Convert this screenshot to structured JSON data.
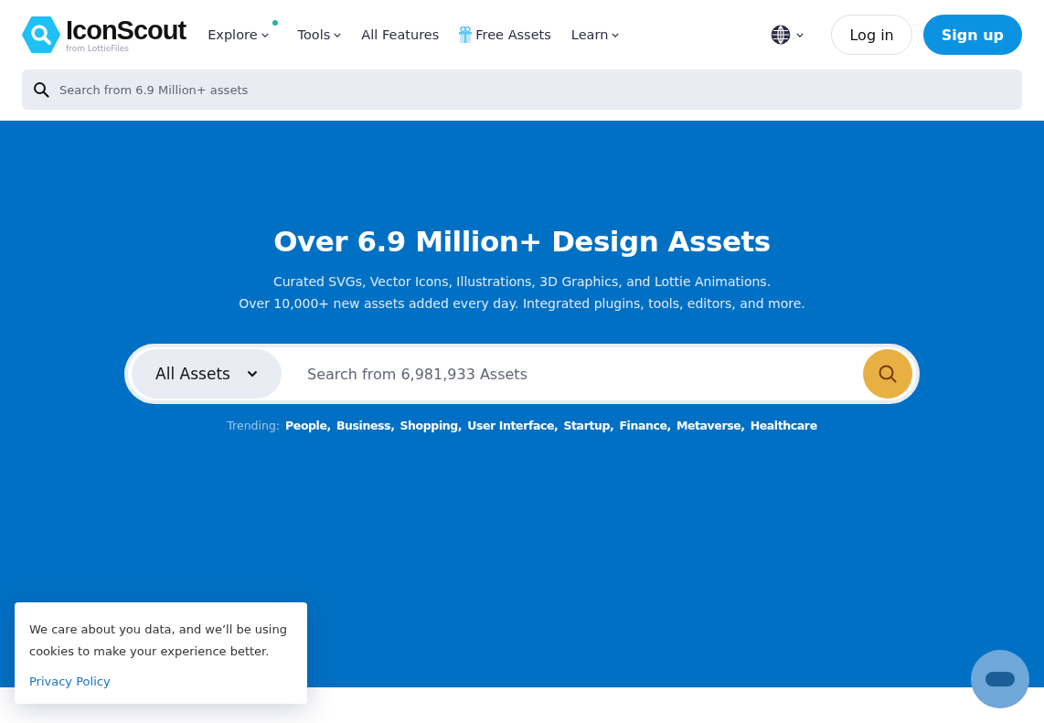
{
  "header": {
    "logo": {
      "name": "IconScout",
      "tagline": "from LottieFiles"
    },
    "nav": [
      {
        "label": "Explore",
        "dropdown": true,
        "dot": true
      },
      {
        "label": "Tools",
        "dropdown": true,
        "dot": false
      },
      {
        "label": "All Features",
        "dropdown": false,
        "dot": false
      },
      {
        "label": "Free Assets",
        "dropdown": false,
        "dot": false,
        "kind": "gift"
      },
      {
        "label": "Learn",
        "dropdown": true,
        "dot": false
      }
    ],
    "login": "Log in",
    "signup": "Sign up",
    "search": {
      "placeholder": "Search from 6.9 Million+ assets"
    }
  },
  "hero": {
    "title": "Over 6.9 Million+ Design Assets",
    "subtitle": [
      "Curated SVGs, Vector Icons, Illustrations, 3D Graphics, and Lottie Animations.",
      "Over 10,000+ new assets added every day. Integrated plugins, tools, editors, and more."
    ],
    "asset_type": "All Assets",
    "search": {
      "placeholder": "Search from 6,981,933 Assets"
    },
    "trending_label": "Trending:",
    "trending": [
      "People,",
      "Business,",
      "Shopping,",
      "User Interface,",
      "Startup,",
      "Finance,",
      "Metaverse,",
      "Healthcare"
    ]
  },
  "cookie": {
    "text": "We care about you data, and we’ll be using cookies to make your experience better.",
    "link": "Privacy Policy"
  }
}
